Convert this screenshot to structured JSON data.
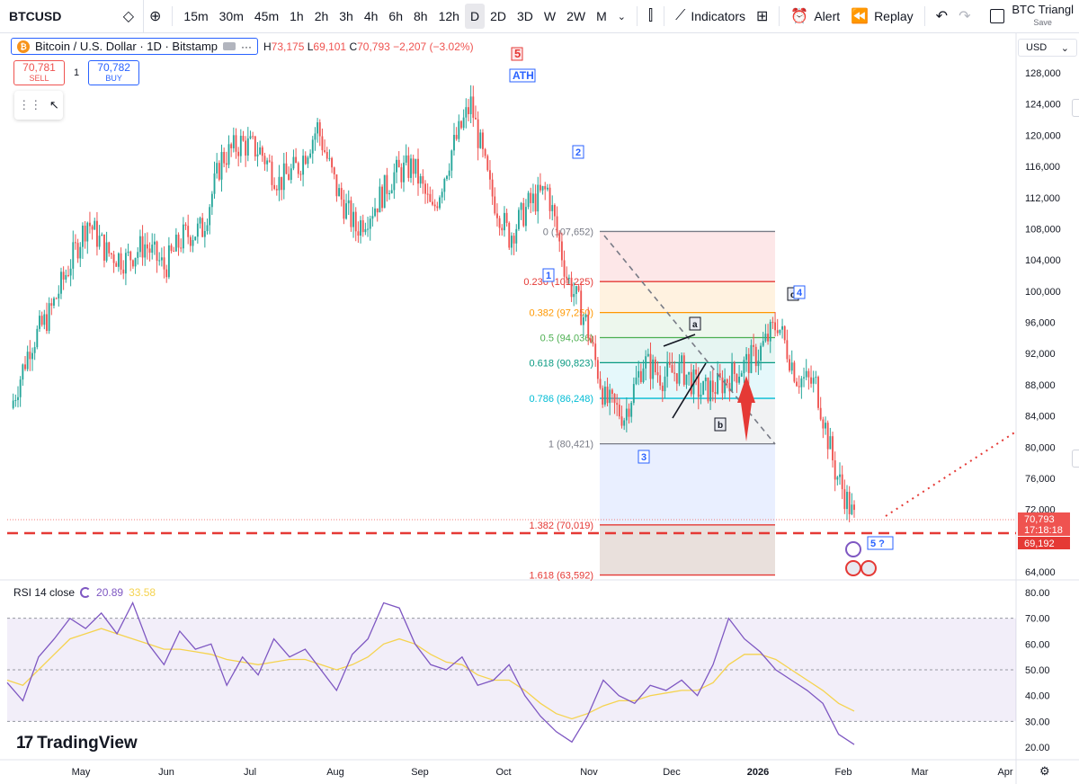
{
  "toolbar": {
    "symbol": "BTCUSD",
    "intervals": [
      "15m",
      "30m",
      "45m",
      "1h",
      "2h",
      "3h",
      "4h",
      "6h",
      "8h",
      "12h",
      "D",
      "2D",
      "3D",
      "W",
      "2W",
      "M"
    ],
    "active_interval": "D",
    "indicators_label": "Indicators",
    "alert_label": "Alert",
    "replay_label": "Replay",
    "layout_name": "BTC Triangl",
    "layout_save": "Save"
  },
  "legend": {
    "title": "Bitcoin / U.S. Dollar · 1D · Bitstamp",
    "h_label": "H",
    "h": "73,175",
    "l_label": "L",
    "l": "69,101",
    "c_label": "C",
    "c": "70,793",
    "change": "−2,207 (−3.02%)"
  },
  "trade": {
    "sell_price": "70,781",
    "sell_label": "SELL",
    "qty": "1",
    "buy_price": "70,782",
    "buy_label": "BUY"
  },
  "price_scale": {
    "currency": "USD"
  },
  "colors": {
    "up": "#26a69a",
    "down": "#ef5350",
    "rsi": "#7e57c2",
    "rsi_ma": "#f5d34f",
    "red_line": "#e53935",
    "brand": "#131722"
  },
  "chart_data": [
    {
      "type": "candlestick",
      "title": "Bitcoin / U.S. Dollar · 1D · Bitstamp",
      "y_axis_ticks": [
        128000,
        124000,
        120000,
        116000,
        112000,
        108000,
        104000,
        100000,
        96000,
        92000,
        88000,
        84000,
        80000,
        76000,
        72000,
        68000,
        64000
      ],
      "ylim": [
        62600,
        130600
      ],
      "x_tick_labels": [
        "May",
        "Jun",
        "Jul",
        "Aug",
        "Sep",
        "Oct",
        "Nov",
        "Dec",
        "2026",
        "Feb",
        "Mar",
        "Apr"
      ],
      "last_price": "70,793",
      "countdown": "17:18:18",
      "line_price_label": "69,192",
      "series": [
        {
          "name": "BTCUSD",
          "x": [
            "Apr 24",
            "May 1",
            "May 8",
            "May 15",
            "May 22",
            "May 29",
            "Jun 5",
            "Jun 12",
            "Jun 19",
            "Jun 26",
            "Jul 3",
            "Jul 10",
            "Jul 17",
            "Jul 24",
            "Jul 31",
            "Aug 7",
            "Aug 14",
            "Aug 21",
            "Aug 28",
            "Sep 4",
            "Sep 11",
            "Sep 18",
            "Sep 25",
            "Oct 2",
            "Oct 6",
            "Oct 10",
            "Oct 17",
            "Oct 24",
            "Oct 28",
            "Nov 4",
            "Nov 11",
            "Nov 18",
            "Nov 21",
            "Nov 28",
            "Dec 5",
            "Dec 12",
            "Dec 19",
            "Dec 26",
            "Jan 2",
            "Jan 9",
            "Jan 14",
            "Jan 20",
            "Jan 27",
            "Feb 1",
            "Feb 3"
          ],
          "close": [
            85000,
            93000,
            97000,
            103000,
            109000,
            105000,
            104000,
            106000,
            103000,
            107000,
            108000,
            117000,
            119000,
            118000,
            114000,
            116000,
            121000,
            113000,
            108000,
            111000,
            115000,
            116000,
            110000,
            118000,
            124000,
            113000,
            107000,
            111000,
            113000,
            102000,
            96000,
            86000,
            84000,
            91000,
            89000,
            90000,
            87000,
            88000,
            90000,
            92000,
            96000,
            89000,
            88000,
            77000,
            70793
          ]
        }
      ],
      "annotations": [
        "5",
        "ATH",
        "2",
        "1",
        "3",
        "a",
        "b",
        "c",
        "4",
        "5 ?"
      ],
      "fibonacci": [
        {
          "ratio": "0",
          "price_text": "(107,652)"
        },
        {
          "ratio": "0.236",
          "price_text": "(101,225)"
        },
        {
          "ratio": "0.382",
          "price_text": "(97,250)"
        },
        {
          "ratio": "0.5",
          "price_text": "(94,036)"
        },
        {
          "ratio": "0.618",
          "price_text": "(90,823)"
        },
        {
          "ratio": "0.786",
          "price_text": "(86,248)"
        },
        {
          "ratio": "1",
          "price_text": "(80,421)"
        },
        {
          "ratio": "1.382",
          "price_text": "(70,019)"
        },
        {
          "ratio": "1.618",
          "price_text": "(63,592)"
        }
      ]
    },
    {
      "type": "line",
      "title": "RSI 14 close",
      "current_values": [
        "20.89",
        "33.58"
      ],
      "y_axis_ticks": [
        80,
        70,
        60,
        50,
        40,
        30,
        20
      ],
      "ylim": [
        17,
        83
      ],
      "bands": [
        30,
        50,
        70
      ],
      "series": [
        {
          "name": "RSI",
          "values": [
            45,
            38,
            55,
            62,
            70,
            66,
            72,
            64,
            76,
            60,
            52,
            65,
            58,
            60,
            44,
            55,
            48,
            62,
            55,
            58,
            50,
            42,
            56,
            62,
            76,
            74,
            60,
            52,
            50,
            55,
            44,
            46,
            52,
            40,
            32,
            26,
            22,
            32,
            46,
            40,
            37,
            44,
            42,
            46,
            40,
            52,
            70,
            62,
            57,
            50,
            46,
            42,
            37,
            25,
            21
          ]
        },
        {
          "values": [
            46,
            44,
            50,
            56,
            62,
            64,
            66,
            64,
            62,
            60,
            58,
            58,
            57,
            56,
            54,
            53,
            52,
            53,
            54,
            54,
            52,
            50,
            52,
            55,
            60,
            62,
            60,
            56,
            53,
            52,
            48,
            46,
            46,
            42,
            37,
            33,
            31,
            33,
            36,
            38,
            38,
            40,
            41,
            42,
            42,
            45,
            52,
            56,
            56,
            54,
            50,
            46,
            42,
            37,
            34
          ]
        }
      ]
    }
  ],
  "rsi_legend": {
    "label": "RSI 14 close",
    "value1": "20.89",
    "value2": "33.58"
  },
  "branding": {
    "logo_text": "TradingView",
    "logo_mark": "17"
  }
}
